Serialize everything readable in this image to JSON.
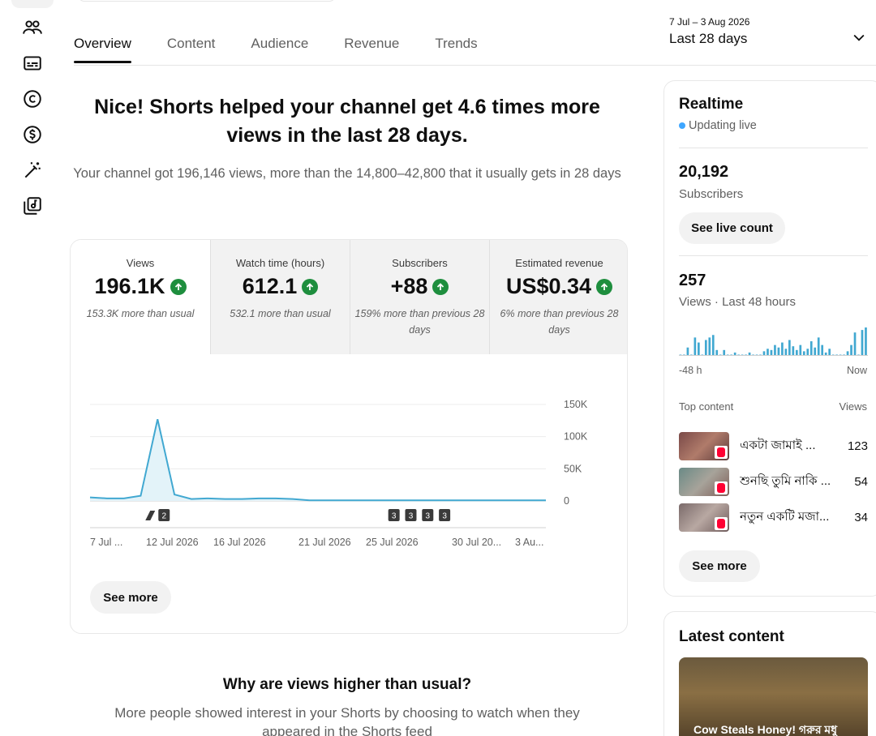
{
  "tabs": [
    {
      "label": "Overview"
    },
    {
      "label": "Content"
    },
    {
      "label": "Audience"
    },
    {
      "label": "Revenue"
    },
    {
      "label": "Trends"
    }
  ],
  "date_range": {
    "dates": "7 Jul – 3 Aug 2026",
    "label": "Last 28 days"
  },
  "headline": "Nice! Shorts helped your channel get 4.6 times more views in the last 28 days.",
  "subline": "Your channel got 196,146 views, more than the 14,800–42,800 that it usually gets in 28 days",
  "metrics": [
    {
      "label": "Views",
      "value": "196.1K",
      "note": "153.3K more than usual"
    },
    {
      "label": "Watch time (hours)",
      "value": "612.1",
      "note": "532.1 more than usual"
    },
    {
      "label": "Subscribers",
      "value": "+88",
      "note": "159% more than previous 28 days"
    },
    {
      "label": "Estimated revenue",
      "value": "US$0.34",
      "note": "6% more than previous 28 days"
    }
  ],
  "chart_data": {
    "type": "area",
    "x": [
      "7 Jul",
      "8 Jul",
      "9 Jul",
      "10 Jul",
      "11 Jul",
      "12 Jul",
      "13 Jul",
      "14 Jul",
      "15 Jul",
      "16 Jul",
      "17 Jul",
      "18 Jul",
      "19 Jul",
      "20 Jul",
      "21 Jul",
      "22 Jul",
      "23 Jul",
      "24 Jul",
      "25 Jul",
      "26 Jul",
      "27 Jul",
      "28 Jul",
      "29 Jul",
      "30 Jul",
      "31 Jul",
      "1 Aug",
      "2 Aug",
      "3 Aug"
    ],
    "values": [
      5500,
      4000,
      4000,
      8000,
      127000,
      10000,
      3000,
      4000,
      3000,
      3000,
      4000,
      4000,
      3000,
      1000,
      1000,
      1000,
      1000,
      1000,
      1000,
      1000,
      1000,
      1000,
      1000,
      1000,
      1000,
      1000,
      1000,
      1000
    ],
    "x_tick_labels": [
      "7 Jul ...",
      "12 Jul 2026",
      "16 Jul 2026",
      "21 Jul 2026",
      "25 Jul 2026",
      "30 Jul 20...",
      "3 Au..."
    ],
    "y_tick_labels": [
      "150K",
      "100K",
      "50K",
      "0"
    ],
    "ylim": [
      0,
      150000
    ],
    "grid": true,
    "markers": [
      {
        "day_index": 4,
        "kind": "shorts",
        "text": "2"
      },
      {
        "day_index": 18,
        "kind": "video",
        "text": "3"
      },
      {
        "day_index": 19,
        "kind": "video",
        "text": "3"
      },
      {
        "day_index": 20,
        "kind": "video",
        "text": "3"
      },
      {
        "day_index": 21,
        "kind": "video",
        "text": "3"
      }
    ],
    "line_color": "#41a8d1",
    "fill_color": "#e3f3f9"
  },
  "see_more_label": "See more",
  "why": {
    "title": "Why are views higher than usual?",
    "body": "More people showed interest in your Shorts by choosing to watch when they appeared in the Shorts feed"
  },
  "realtime": {
    "title": "Realtime",
    "live": "Updating live",
    "subscribers_value": "20,192",
    "subscribers_label": "Subscribers",
    "see_live_count": "See live count",
    "views_value": "257",
    "views_label": "Views · Last 48 hours",
    "axis_left": "-48 h",
    "axis_right": "Now",
    "top_content_label": "Top content",
    "views_col_label": "Views",
    "spark_values": [
      0,
      0,
      6,
      0,
      14,
      10,
      0,
      12,
      14,
      16,
      4,
      0,
      4,
      0,
      0,
      2,
      0,
      0,
      0,
      2,
      0,
      0,
      0,
      3,
      5,
      4,
      8,
      6,
      10,
      5,
      12,
      7,
      4,
      8,
      3,
      5,
      11,
      6,
      14,
      8,
      2,
      5,
      0,
      0,
      0,
      0,
      3,
      8,
      18,
      0,
      20,
      22
    ],
    "items": [
      {
        "title": "একটা জামাই ...",
        "views": "123"
      },
      {
        "title": "শুনছি তুমি নাকি ...",
        "views": "54"
      },
      {
        "title": "নতুন একটি মজা...",
        "views": "34"
      }
    ],
    "see_more": "See more"
  },
  "latest": {
    "title": "Latest content",
    "caption": "Cow Steals Honey! গরুর মধু"
  },
  "colors": {
    "accent_green": "#1e8e3e",
    "live_blue": "#3ea6ff",
    "shorts_red": "#ff0033"
  }
}
